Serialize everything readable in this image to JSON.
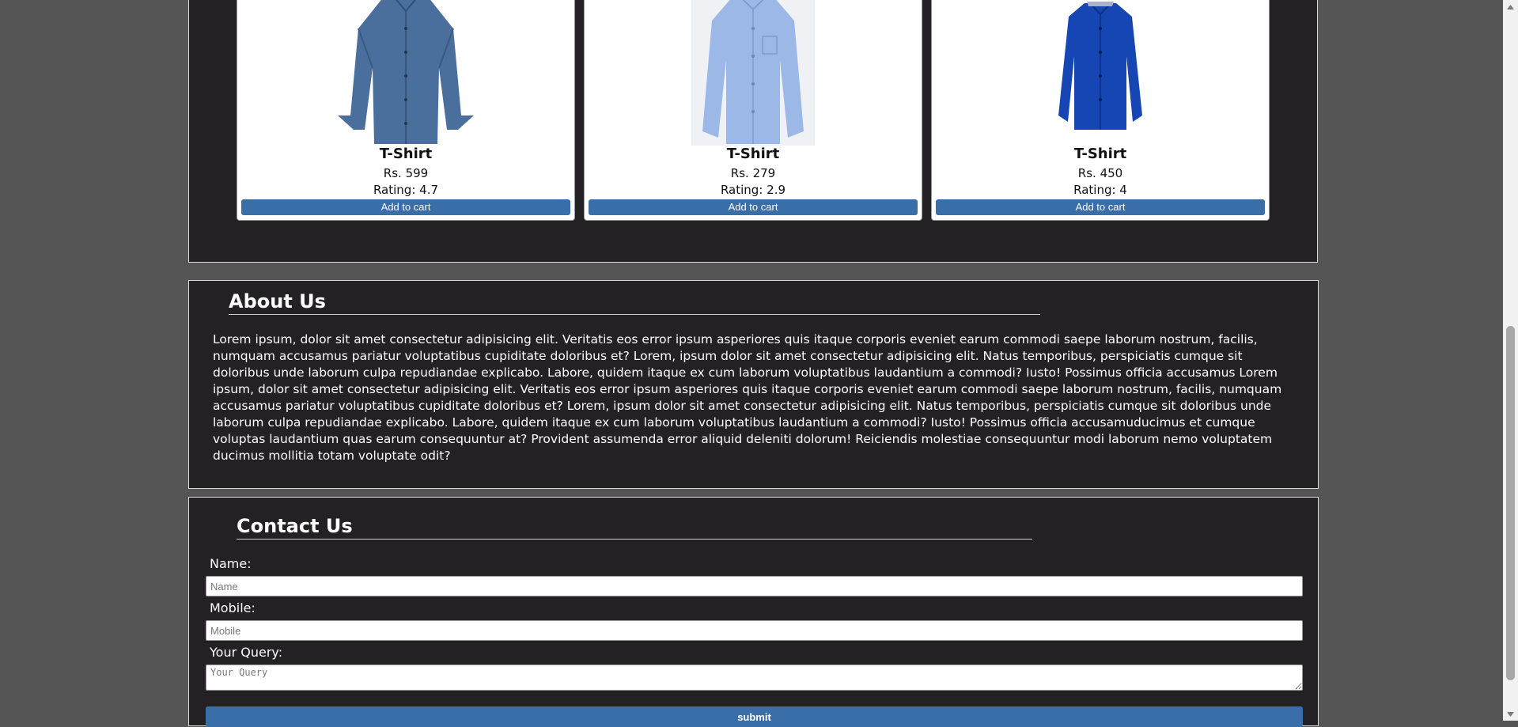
{
  "products": [
    {
      "name": "T-Shirt",
      "price": "Rs. 599",
      "rating": "Rating: 4.7",
      "button": "Add to cart",
      "image": "dark-blue-denim-shirt",
      "color": "#4a6f9c"
    },
    {
      "name": "T-Shirt",
      "price": "Rs. 279",
      "rating": "Rating: 2.9",
      "button": "Add to cart",
      "image": "light-blue-dress-shirt",
      "color": "#9cb8e6"
    },
    {
      "name": "T-Shirt",
      "price": "Rs. 450",
      "rating": "Rating: 4",
      "button": "Add to cart",
      "image": "royal-blue-shirt",
      "color": "#1646b4"
    }
  ],
  "about": {
    "heading": "About Us",
    "text": "Lorem ipsum, dolor sit amet consectetur adipisicing elit. Veritatis eos error ipsum asperiores quis itaque corporis eveniet earum commodi saepe laborum nostrum, facilis, numquam accusamus pariatur voluptatibus cupiditate doloribus et? Lorem, ipsum dolor sit amet consectetur adipisicing elit. Natus temporibus, perspiciatis cumque sit doloribus unde laborum culpa repudiandae explicabo. Labore, quidem itaque ex cum laborum voluptatibus laudantium a commodi? Iusto! Possimus officia accusamus Lorem ipsum, dolor sit amet consectetur adipisicing elit. Veritatis eos error ipsum asperiores quis itaque corporis eveniet earum commodi saepe laborum nostrum, facilis, numquam accusamus pariatur voluptatibus cupiditate doloribus et? Lorem, ipsum dolor sit amet consectetur adipisicing elit. Natus temporibus, perspiciatis cumque sit doloribus unde laborum culpa repudiandae explicabo. Labore, quidem itaque ex cum laborum voluptatibus laudantium a commodi? Iusto! Possimus officia accusamuducimus et cumque voluptas laudantium quas earum consequuntur at? Provident assumenda error aliquid deleniti dolorum! Reiciendis molestiae consequuntur modi laborum nemo voluptatem ducimus mollitia totam voluptate odit?"
  },
  "contact": {
    "heading": "Contact Us",
    "name_label": "Name:",
    "name_placeholder": "Name",
    "mobile_label": "Mobile:",
    "mobile_placeholder": "Mobile",
    "query_label": "Your Query:",
    "query_placeholder": "Your Query",
    "submit_label": "submit"
  },
  "colors": {
    "page_background": "#555555",
    "section_background": "#232123",
    "button": "#3a6ea8"
  }
}
